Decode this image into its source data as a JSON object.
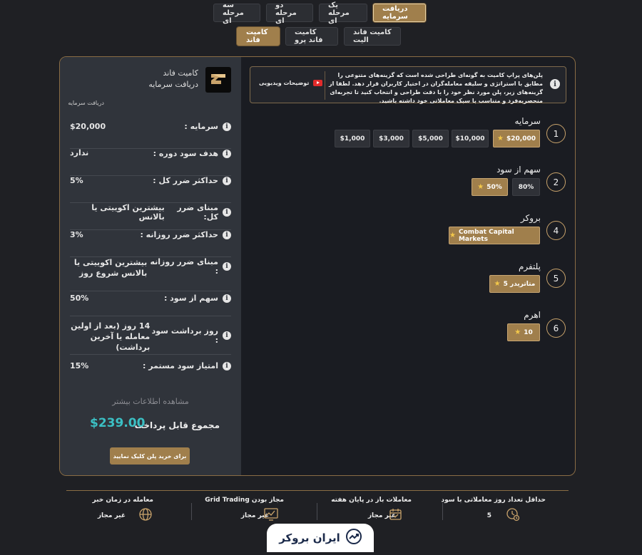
{
  "top_tabs": [
    {
      "label": "سه مرحله ای"
    },
    {
      "label": "دو مرحله ای"
    },
    {
      "label": "یک مرحله ای"
    },
    {
      "label": "دریافت سرمایه"
    }
  ],
  "sub_tabs": [
    {
      "label": "کامیت فاند الیت"
    },
    {
      "label": "کامیت فاند پرو"
    },
    {
      "label": "کامیت فاند"
    }
  ],
  "summary": {
    "brand_name": "کامیت فاند",
    "brand_sub": "دریافت سرمایه",
    "caption": "دریافت سرمایه",
    "rows": [
      {
        "label": "سرمایه :",
        "value": "$20,000"
      },
      {
        "label": "هدف سود دوره :",
        "value": "ندارد"
      },
      {
        "label": "حداکثر ضرر کل :",
        "value": "5%"
      },
      {
        "label": "مبنای ضرر کل:",
        "value": "بیشترین اکوییتی یا بالانس"
      },
      {
        "label": "حداکثر ضرر روزانه :",
        "value": "3%"
      },
      {
        "label": "مبنای ضرر روزانه :",
        "value": "بیشترین اکوییتی یا بالانس شروع روز"
      },
      {
        "label": "سهم از سود :",
        "value": "50%"
      },
      {
        "label": "روز برداشت سود :",
        "value": "14 روز (بعد از اولین معامله یا آخرین برداشت)"
      },
      {
        "label": "امتیاز سود مستمر :",
        "value": "15%"
      }
    ],
    "more_info": "مشاهده اطلاعات بیشتر",
    "total_label": "مجموع قابل پرداخت",
    "total_value": "$239.00",
    "buy_label": "برای خرید پلن کلیک نمایید"
  },
  "notice": {
    "text": "پلن‌های پراپ کامیت به گونه‌ای طراحی شده است که گزینه‌های متنوعی را مطابق با استراتژی و سلیقه معامله‌گران در اختیار کاربران قرار دهد. لطفا از گزینه‌های زیر، پلن مورد نظر خود را با دقت طراحی و انتخاب کنید تا تجربه‌ای منحصربه‌فرد و متناسب با سبک معاملاتی خود داشته باشید.",
    "video_label": "توضیحات ویدیویی"
  },
  "steps": [
    {
      "num": "1",
      "title": "سرمایه",
      "options": [
        "$20,000",
        "$10,000",
        "$5,000",
        "$3,000",
        "$1,000"
      ]
    },
    {
      "num": "2",
      "title": "سهم از سود",
      "options": [
        "80%",
        "50%"
      ]
    },
    {
      "num": "4",
      "title": "بروکر",
      "options": [
        "Combat Capital Markets"
      ]
    },
    {
      "num": "5",
      "title": "پلتفرم",
      "options": [
        "متاتریدر 5"
      ]
    },
    {
      "num": "6",
      "title": "اهرم",
      "options": [
        "10"
      ]
    }
  ],
  "features": [
    {
      "title": "حداقل تعداد روز معاملاتی با سود",
      "value": "5",
      "icon": "calendar-clock-icon"
    },
    {
      "title": "معاملات باز در پایان هفته",
      "value": "غیر مجاز",
      "icon": "calendar-icon"
    },
    {
      "title": "مجاز بودن Grid Trading",
      "value": "غیر مجاز",
      "icon": "chart-icon"
    },
    {
      "title": "معامله در زمان خبر",
      "value": "غیر مجاز",
      "icon": "globe-icon"
    }
  ],
  "watermark": "ایران بروکر",
  "colors": {
    "accent": "#a07f4c",
    "total": "#3bc0c4",
    "star": "#f3c84a"
  }
}
